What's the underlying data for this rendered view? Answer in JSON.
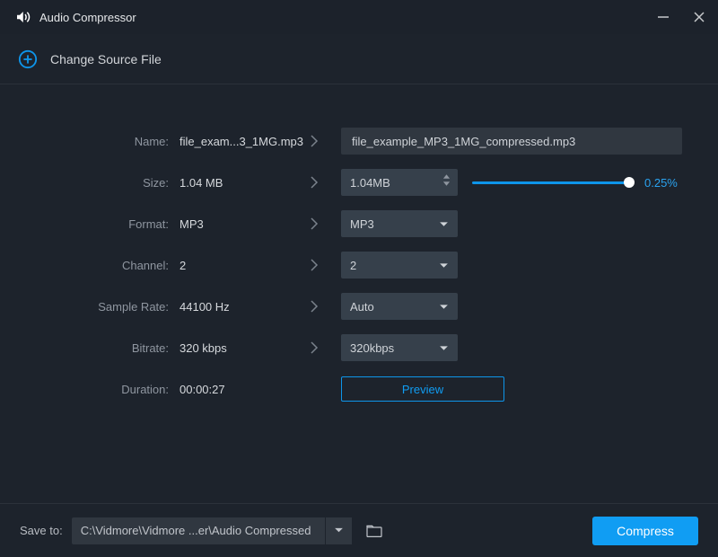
{
  "titlebar": {
    "title": "Audio Compressor"
  },
  "sourcebar": {
    "label": "Change Source File"
  },
  "form": {
    "name": {
      "label": "Name:",
      "input": "file_exam...3_1MG.mp3",
      "output": "file_example_MP3_1MG_compressed.mp3"
    },
    "size": {
      "label": "Size:",
      "input": "1.04 MB",
      "output": "1.04MB",
      "percent": "0.25%"
    },
    "format": {
      "label": "Format:",
      "input": "MP3",
      "output": "MP3"
    },
    "channel": {
      "label": "Channel:",
      "input": "2",
      "output": "2"
    },
    "sample_rate": {
      "label": "Sample Rate:",
      "input": "44100 Hz",
      "output": "Auto"
    },
    "bitrate": {
      "label": "Bitrate:",
      "input": "320 kbps",
      "output": "320kbps"
    },
    "duration": {
      "label": "Duration:",
      "input": "00:00:27"
    },
    "preview": "Preview"
  },
  "bottom": {
    "saveto_label": "Save to:",
    "path": "C:\\Vidmore\\Vidmore ...er\\Audio Compressed",
    "compress": "Compress"
  }
}
